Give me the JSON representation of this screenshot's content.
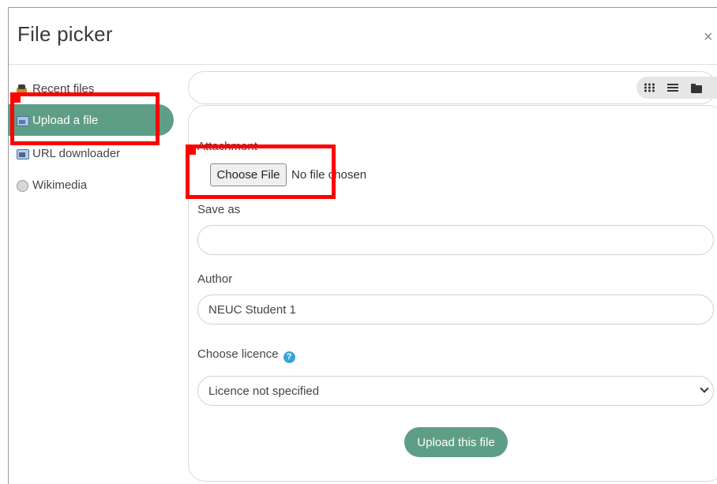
{
  "dialog": {
    "title": "File picker",
    "close_symbol": "×"
  },
  "sidebar": {
    "items": [
      {
        "label": "Recent files",
        "icon": "recent-files-icon"
      },
      {
        "label": "Upload a file",
        "icon": "upload-icon",
        "active": true
      },
      {
        "label": "URL downloader",
        "icon": "url-downloader-icon"
      },
      {
        "label": "Wikimedia",
        "icon": "wikimedia-icon"
      }
    ]
  },
  "toolbar": {
    "views": [
      "icons-view-icon",
      "list-view-icon",
      "tree-view-icon"
    ]
  },
  "form": {
    "attachment_label": "Attachment",
    "choose_file_label": "Choose File",
    "no_file_text": "No file chosen",
    "save_as_label": "Save as",
    "save_as_value": "",
    "author_label": "Author",
    "author_value": "NEUC Student 1",
    "licence_label": "Choose licence",
    "licence_help": "?",
    "licence_selected": "Licence not specified",
    "upload_button": "Upload this file"
  },
  "colors": {
    "accent": "#5e9e86",
    "highlight": "#ff0000",
    "help": "#3aa3d8"
  }
}
